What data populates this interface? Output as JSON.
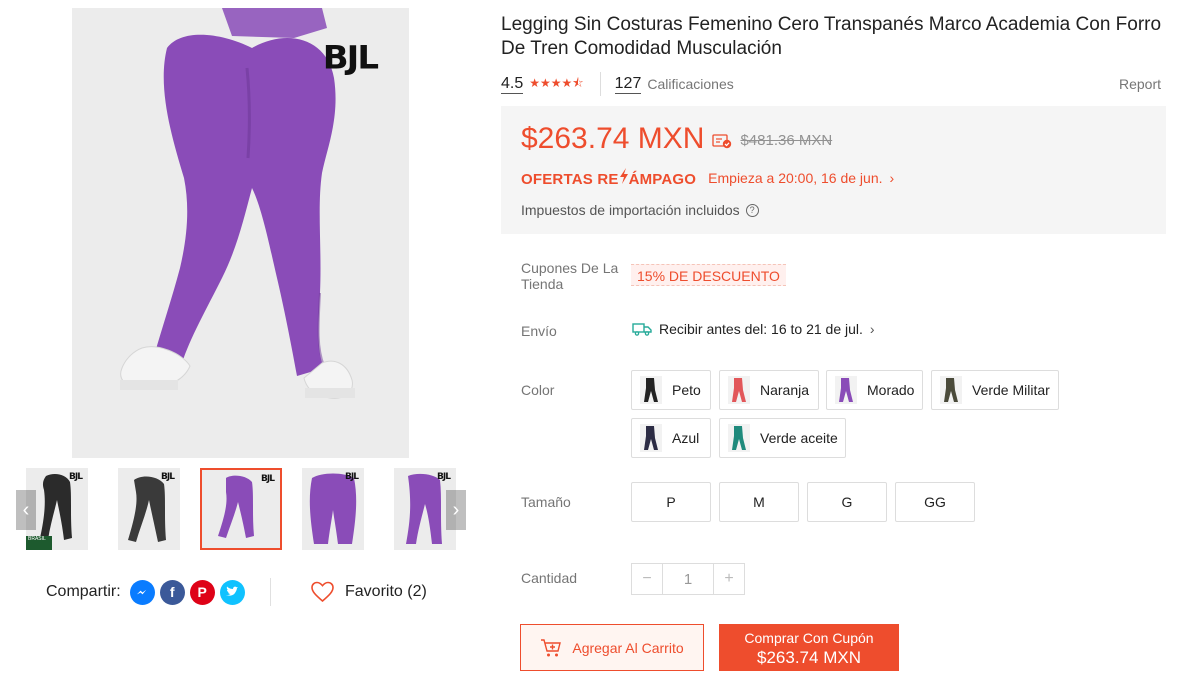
{
  "product": {
    "brand_logo": "BJL",
    "title": "Legging Sin Costuras Femenino Cero Transpanés Marco Academia Con Forro De Tren Comodidad Musculación",
    "rating": "4.5",
    "rating_stars": "★★★★⯪",
    "ratings_count": "127",
    "ratings_label": "Calificaciones",
    "report_label": "Report"
  },
  "gallery": {
    "main_color": "#8a4cb8",
    "thumbnails": [
      {
        "color": "#2b2b2b",
        "badge": "BRASIL"
      },
      {
        "color": "#3a3a3a"
      },
      {
        "color": "#8a4cb8",
        "active": true
      },
      {
        "color": "#8a4cb8"
      },
      {
        "color": "#8a4cb8"
      }
    ],
    "prev_icon": "chevron-left-icon",
    "next_icon": "chevron-right-icon"
  },
  "share": {
    "label": "Compartir:",
    "networks": [
      "messenger-icon",
      "facebook-icon",
      "pinterest-icon",
      "twitter-icon"
    ],
    "favorite_label": "Favorito (2)"
  },
  "price": {
    "current": "$263.74 MXN",
    "original": "$481.36 MXN",
    "flash_logo_a": "OFERTAS RE",
    "flash_logo_b": "ÁMPAGO",
    "flash_start": "Empieza a 20:00, 16 de jun.",
    "tax_note": "Impuestos de importación incluidos",
    "accent": "#ee4d2d"
  },
  "coupons": {
    "label": "Cupones De La Tienda",
    "tag": "15% DE DESCUENTO"
  },
  "shipping": {
    "label": "Envío",
    "text": "Recibir antes del: 16 to 21 de jul."
  },
  "color_option": {
    "label": "Color",
    "options": [
      {
        "name": "Peto",
        "swatch": "#222222"
      },
      {
        "name": "Naranja",
        "swatch": "#e2575a"
      },
      {
        "name": "Morado",
        "swatch": "#8a4cb8"
      },
      {
        "name": "Verde Militar",
        "swatch": "#4a4a3a"
      },
      {
        "name": "Azul",
        "swatch": "#2c2c44"
      },
      {
        "name": "Verde aceite",
        "swatch": "#1f8a7c"
      }
    ]
  },
  "size_option": {
    "label": "Tamaño",
    "options": [
      "P",
      "M",
      "G",
      "GG"
    ]
  },
  "quantity": {
    "label": "Cantidad",
    "value": "1",
    "minus": "−",
    "plus": "+"
  },
  "actions": {
    "add_to_cart": "Agregar Al Carrito",
    "buy_line1": "Comprar Con Cupón",
    "buy_line2": "$263.74 MXN"
  }
}
